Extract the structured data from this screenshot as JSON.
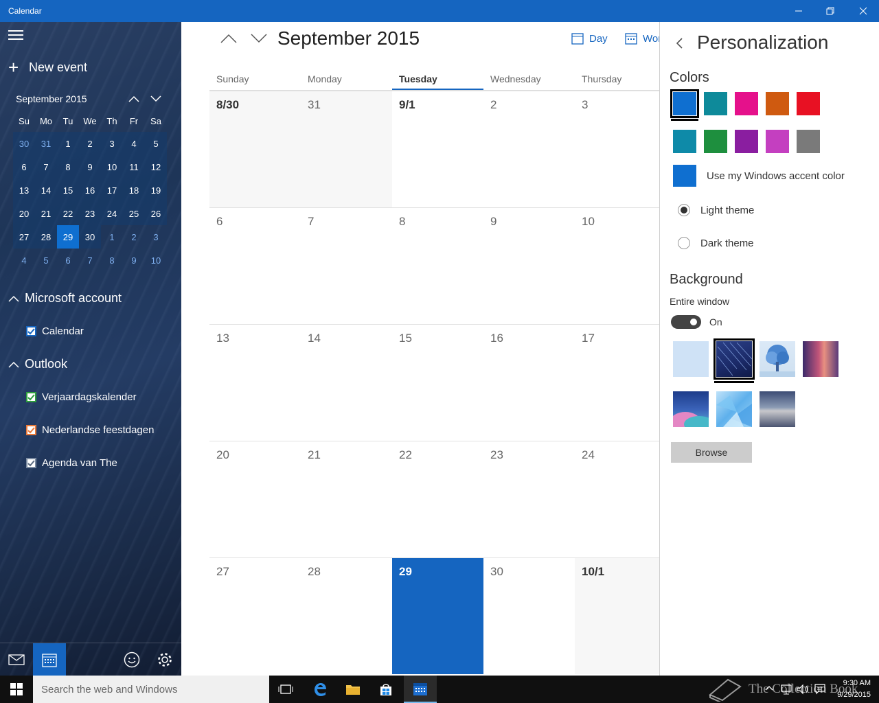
{
  "window": {
    "title": "Calendar",
    "minimize_icon": "minimize-icon",
    "restore_icon": "restore-icon",
    "close_icon": "close-icon"
  },
  "sidebar": {
    "new_event": "New event",
    "mini_calendar": {
      "title": "September 2015",
      "weekdays": [
        "Su",
        "Mo",
        "Tu",
        "We",
        "Th",
        "Fr",
        "Sa"
      ],
      "weeks": [
        [
          "30",
          "31",
          "1",
          "2",
          "3",
          "4",
          "5"
        ],
        [
          "6",
          "7",
          "8",
          "9",
          "10",
          "11",
          "12"
        ],
        [
          "13",
          "14",
          "15",
          "16",
          "17",
          "18",
          "19"
        ],
        [
          "20",
          "21",
          "22",
          "23",
          "24",
          "25",
          "26"
        ],
        [
          "27",
          "28",
          "29",
          "30",
          "1",
          "2",
          "3"
        ],
        [
          "4",
          "5",
          "6",
          "7",
          "8",
          "9",
          "10"
        ]
      ],
      "today": "29"
    },
    "groups": [
      {
        "name": "Microsoft account",
        "calendars": [
          {
            "label": "Calendar",
            "color": "#1565c0",
            "checked": true
          }
        ]
      },
      {
        "name": "Outlook",
        "calendars": [
          {
            "label": "Verjaardagskalender",
            "color": "#2e9e3e",
            "checked": true
          },
          {
            "label": "Nederlandse feestdagen",
            "color": "#e8793a",
            "checked": true
          },
          {
            "label": "Agenda van The",
            "color": "#7a8aa0",
            "checked": true
          }
        ]
      }
    ],
    "bottom_icons": [
      "mail-icon",
      "calendar-icon",
      "feedback-icon",
      "settings-icon"
    ]
  },
  "main": {
    "month_title": "September 2015",
    "views": [
      {
        "label": "Day",
        "icon": "day-view-icon"
      },
      {
        "label": "Wor",
        "icon": "work-week-icon"
      }
    ],
    "weekdays": [
      "Sunday",
      "Monday",
      "Tuesday",
      "Wednesday",
      "Thursday"
    ],
    "active_weekday": "Tuesday",
    "weeks": [
      [
        "8/30",
        "31",
        "9/1",
        "2",
        "3"
      ],
      [
        "6",
        "7",
        "8",
        "9",
        "10"
      ],
      [
        "13",
        "14",
        "15",
        "16",
        "17"
      ],
      [
        "20",
        "21",
        "22",
        "23",
        "24"
      ],
      [
        "27",
        "28",
        "29",
        "30",
        "10/1"
      ]
    ],
    "today": "29"
  },
  "personalization": {
    "title": "Personalization",
    "colors_heading": "Colors",
    "colors": [
      "#0f6fd0",
      "#0e8a9a",
      "#e5118b",
      "#cf5a10",
      "#e81123",
      "#0e8aa8",
      "#1e8f3e",
      "#8a1ea0",
      "#c43fc0",
      "#7a7a7a"
    ],
    "selected_color": "#0f6fd0",
    "accent_label": "Use my Windows accent color",
    "themes": [
      {
        "label": "Light theme",
        "checked": true
      },
      {
        "label": "Dark theme",
        "checked": false
      }
    ],
    "background_heading": "Background",
    "entire_window_label": "Entire window",
    "toggle_state": "On",
    "browse_label": "Browse"
  },
  "taskbar": {
    "search_placeholder": "Search the web and Windows",
    "time": "9:30 AM",
    "date": "9/29/2015",
    "watermark": "The Collection Book"
  }
}
